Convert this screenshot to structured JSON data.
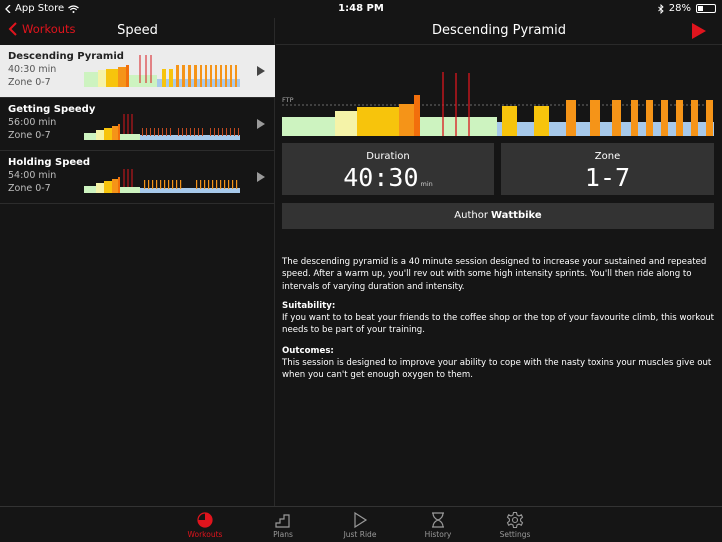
{
  "status_bar": {
    "back_app": "App Store",
    "time": "1:48 PM",
    "battery": "28%"
  },
  "left": {
    "back_label": "Workouts",
    "title": "Speed",
    "workouts": [
      {
        "name": "Descending Pyramid",
        "duration": "40:30 min",
        "zone": "Zone 0-7",
        "selected": true
      },
      {
        "name": "Getting Speedy",
        "duration": "56:00 min",
        "zone": "Zone 0-7",
        "selected": false
      },
      {
        "name": "Holding Speed",
        "duration": "54:00 min",
        "zone": "Zone 0-7",
        "selected": false
      }
    ]
  },
  "detail": {
    "title": "Descending Pyramid",
    "ftp_label": "FTP",
    "duration_label": "Duration",
    "duration_value": "40:30",
    "duration_unit": "min",
    "zone_label": "Zone",
    "zone_value": "1-7",
    "author_prefix": "Author",
    "author_name": "Wattbike",
    "intro": "The descending pyramid is a 40 minute session designed to increase your sustained and repeated speed. After a warm up, you'll rev out with some high intensity sprints. You'll then ride along to intervals of varying duration and intensity.",
    "suitability_heading": "Suitability:",
    "suitability": "If you want to to beat your friends to the coffee shop or the top of your favourite climb, this workout needs to be part of your training.",
    "outcomes_heading": "Outcomes:",
    "outcomes": "This session is designed to improve your ability to cope with the nasty toxins your muscles give out when you can't get enough oxygen to them."
  },
  "tabs": [
    {
      "label": "Workouts",
      "icon": "workouts-dial-icon",
      "active": true
    },
    {
      "label": "Plans",
      "icon": "plans-stairs-icon",
      "active": false
    },
    {
      "label": "Just Ride",
      "icon": "just-ride-play-icon",
      "active": false
    },
    {
      "label": "History",
      "icon": "history-hourglass-icon",
      "active": false
    },
    {
      "label": "Settings",
      "icon": "settings-gear-icon",
      "active": false
    }
  ],
  "colors": {
    "accent": "#e0141d",
    "zone_green": "#cdf3c0",
    "zone_yellow": "#f5f3a8",
    "zone_gold": "#f7c40c",
    "zone_orange": "#f59418",
    "zone_deep_orange": "#f26f0c",
    "zone_blue": "#a7c9ea",
    "sprint_red": "#d9161d"
  }
}
